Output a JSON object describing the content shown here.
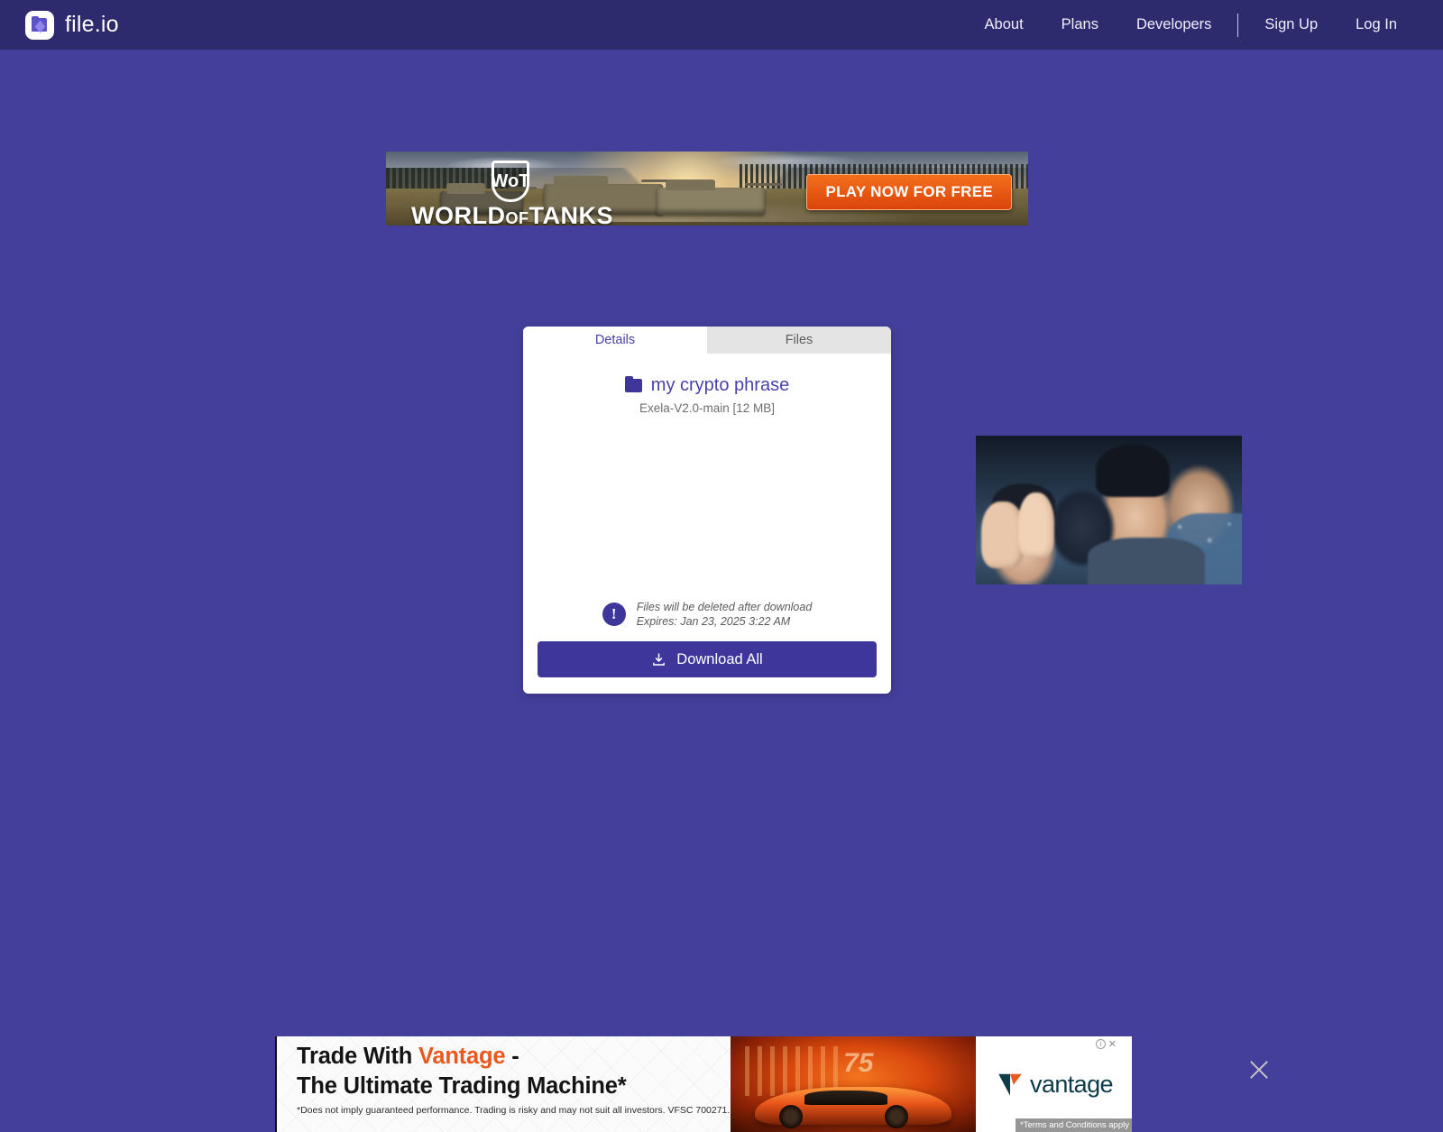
{
  "header": {
    "brand": "file.io",
    "nav": [
      {
        "label": "About"
      },
      {
        "label": "Plans"
      },
      {
        "label": "Developers"
      }
    ],
    "auth": [
      {
        "label": "Sign Up"
      },
      {
        "label": "Log In"
      }
    ],
    "colors": {
      "bar": "#2e2a6e",
      "page_bg": "#443f9b",
      "accent": "#3e369a"
    }
  },
  "top_ad": {
    "brand_mark": "WoT",
    "brand_line1": "WORLD",
    "brand_of": "OF",
    "brand_line2": "TANKS",
    "cta": "PLAY NOW FOR FREE",
    "cta_color": "#e8521a"
  },
  "card": {
    "tabs": [
      {
        "label": "Details",
        "active": true
      },
      {
        "label": "Files",
        "active": false
      }
    ],
    "file_name": "my crypto phrase",
    "file_meta": "Exela-V2.0-main [12 MB]",
    "notice_line1": "Files will be deleted after download",
    "notice_line2": "Expires: Jan 23, 2025 3:22 AM",
    "notice_icon": "exclamation-circle-icon",
    "download_label": "Download All",
    "download_icon": "download-icon",
    "folder_icon": "folder-icon"
  },
  "media": {
    "alt": "audience clapping animation"
  },
  "bottom_ad": {
    "headline_part1": "Trade With ",
    "headline_accent": "Vantage",
    "headline_part2": " -",
    "headline_line2": "The Ultimate Trading Machine*",
    "disclaimer": "*Does not imply guaranteed performance. Trading is risky and may not suit all investors. VFSC 700271.",
    "logo_text": "vantage",
    "terms_badge": "*Terms and Conditions apply",
    "car_number": "75",
    "adchoices_label": "",
    "close_icon": "close-icon",
    "accent_color": "#e8581f",
    "logo_color": "#0d3b4a"
  }
}
